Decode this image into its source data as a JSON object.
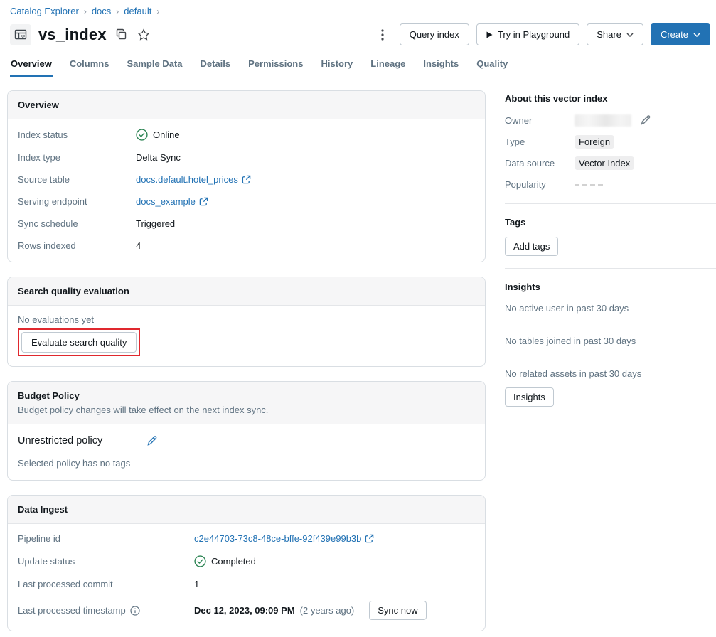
{
  "colors": {
    "accent_blue": "#2272B4",
    "success_green": "#2E8555",
    "annotation_red": "#E0282E",
    "badge_bg": "#EEEEEF"
  },
  "breadcrumb": {
    "items": [
      "Catalog Explorer",
      "docs",
      "default"
    ]
  },
  "header": {
    "title": "vs_index"
  },
  "actions": {
    "query_index": "Query index",
    "try_in_playground": "Try in Playground",
    "share": "Share",
    "create": "Create"
  },
  "tabs": {
    "items": [
      "Overview",
      "Columns",
      "Sample Data",
      "Details",
      "Permissions",
      "History",
      "Lineage",
      "Insights",
      "Quality"
    ],
    "active": "Overview"
  },
  "overview": {
    "title": "Overview",
    "index_status_label": "Index status",
    "index_status_value": "Online",
    "index_type_label": "Index type",
    "index_type_value": "Delta Sync",
    "source_table_label": "Source table",
    "source_table_value": "docs.default.hotel_prices",
    "serving_endpoint_label": "Serving endpoint",
    "serving_endpoint_value": "docs_example",
    "sync_schedule_label": "Sync schedule",
    "sync_schedule_value": "Triggered",
    "rows_indexed_label": "Rows indexed",
    "rows_indexed_value": "4"
  },
  "search_quality": {
    "title": "Search quality evaluation",
    "empty_text": "No evaluations yet",
    "evaluate_button": "Evaluate search quality"
  },
  "budget_policy": {
    "title": "Budget Policy",
    "subtitle": "Budget policy changes will take effect on the next index sync.",
    "policy_name": "Unrestricted policy",
    "no_tags_text": "Selected policy has no tags"
  },
  "data_ingest": {
    "title": "Data Ingest",
    "pipeline_id_label": "Pipeline id",
    "pipeline_id_value": "c2e44703-73c8-48ce-bffe-92f439e99b3b",
    "update_status_label": "Update status",
    "update_status_value": "Completed",
    "last_commit_label": "Last processed commit",
    "last_commit_value": "1",
    "last_timestamp_label": "Last processed timestamp",
    "last_timestamp_value": "Dec 12, 2023, 09:09 PM",
    "last_timestamp_relative": "(2 years ago)",
    "sync_now_button": "Sync now"
  },
  "sidebar": {
    "about_title": "About this vector index",
    "owner_label": "Owner",
    "type_label": "Type",
    "type_value": "Foreign",
    "data_source_label": "Data source",
    "data_source_value": "Vector Index",
    "popularity_label": "Popularity",
    "tags_title": "Tags",
    "add_tags_button": "Add tags",
    "insights_title": "Insights",
    "insights_items": [
      "No active user in past 30 days",
      "No tables joined in past 30 days",
      "No related assets in past 30 days"
    ],
    "insights_button": "Insights"
  }
}
